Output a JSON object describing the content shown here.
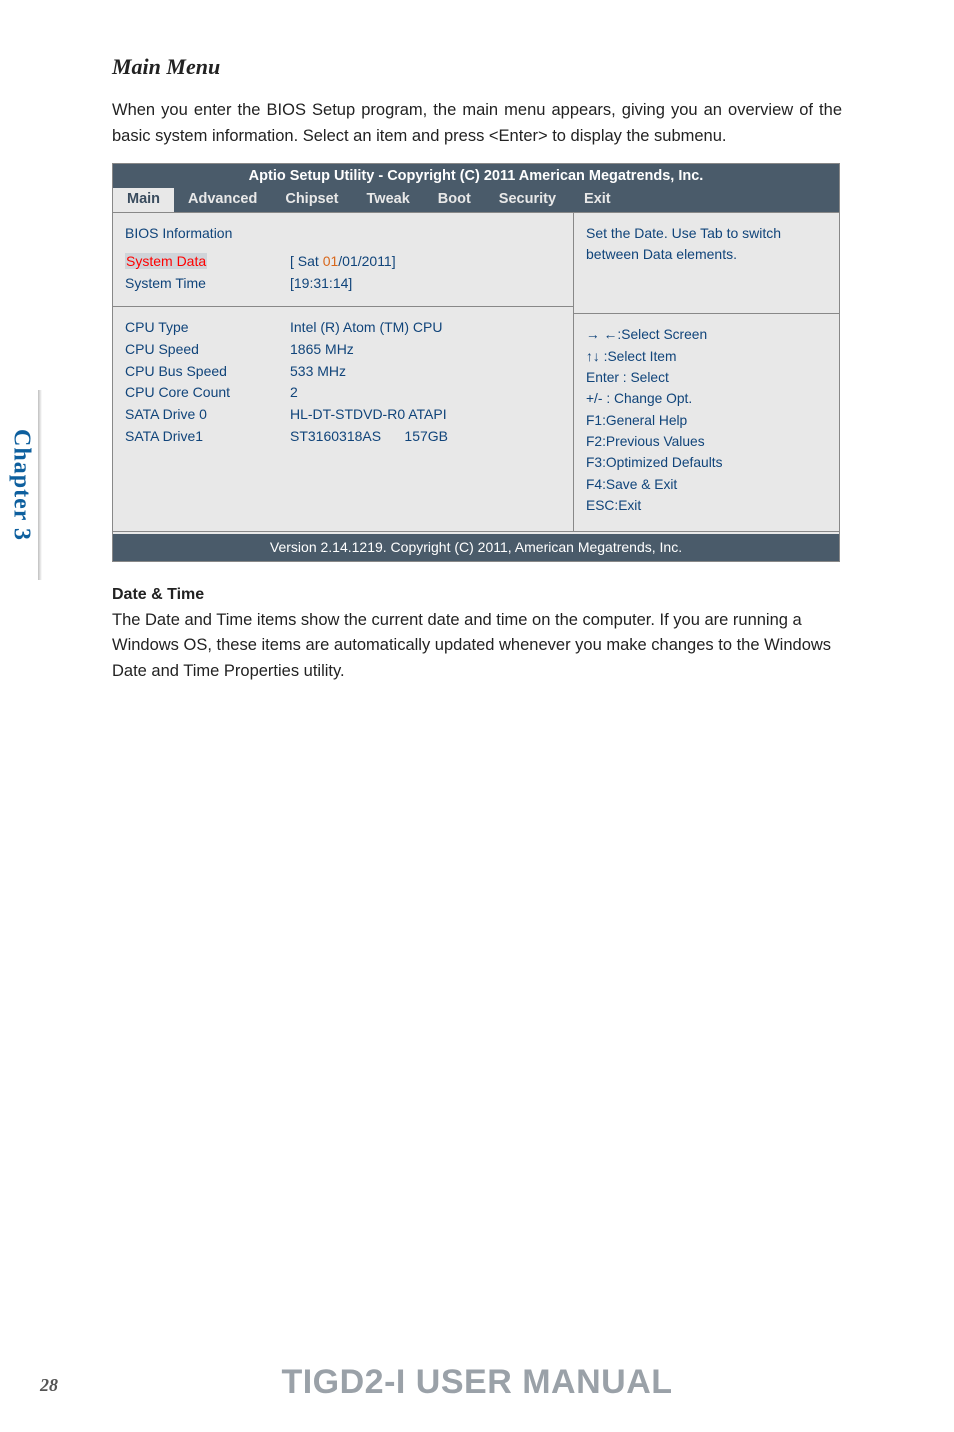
{
  "chapter_tab": "Chapter 3",
  "heading": "Main Menu",
  "intro": "When you enter the BIOS Setup program, the main menu appears, giving you an overview of the basic system information. Select an item and press <Enter> to display the submenu.",
  "bios": {
    "title": "Aptio Setup Utility - Copyright (C) 2011 American Megatrends, Inc.",
    "tabs": [
      "Main",
      "Advanced",
      "Chipset",
      "Tweak",
      "Boot",
      "Security",
      "Exit"
    ],
    "active_tab": "Main",
    "top_section": {
      "bios_info": "BIOS Information",
      "rows": [
        {
          "label": "System Data",
          "value_pre": "[ Sat ",
          "value_hl": "01",
          "value_post": "/01/2011]",
          "highlight": true
        },
        {
          "label": "System Time",
          "value": "[19:31:14]"
        }
      ]
    },
    "bottom_section": {
      "rows": [
        {
          "label": "CPU Type",
          "value": "Intel (R) Atom (TM) CPU"
        },
        {
          "label": "CPU Speed",
          "value": "1865 MHz"
        },
        {
          "label": "CPU Bus Speed",
          "value": "533 MHz"
        },
        {
          "label": "CPU Core Count",
          "value": "2"
        },
        {
          "label": "",
          "value": ""
        },
        {
          "label": "SATA Drive 0",
          "value": "HL-DT-STDVD-R0 ATAPI"
        },
        {
          "label": "SATA Drive1",
          "value": "ST3160318AS      157GB"
        }
      ]
    },
    "help_top": "Set the Date. Use Tab to switch between Data elements.",
    "help_lines": [
      "→ ←:Select Screen",
      "↑↓ :Select Item",
      "Enter : Select",
      "+/-  : Change Opt.",
      "F1:General Help",
      "F2:Previous Values",
      "F3:Optimized Defaults",
      "F4:Save & Exit",
      "ESC:Exit"
    ],
    "footer": "Version 2.14.1219. Copyright (C) 2011, American Megatrends, Inc."
  },
  "date_time": {
    "heading": "Date & Time",
    "body": "The Date and Time items show the current date and time on the computer. If you are running a Windows OS, these items are automatically updated whenever you make changes to the Windows Date and Time Properties utility."
  },
  "page_number": "28",
  "footer_title": "TIGD2-I USER MANUAL"
}
